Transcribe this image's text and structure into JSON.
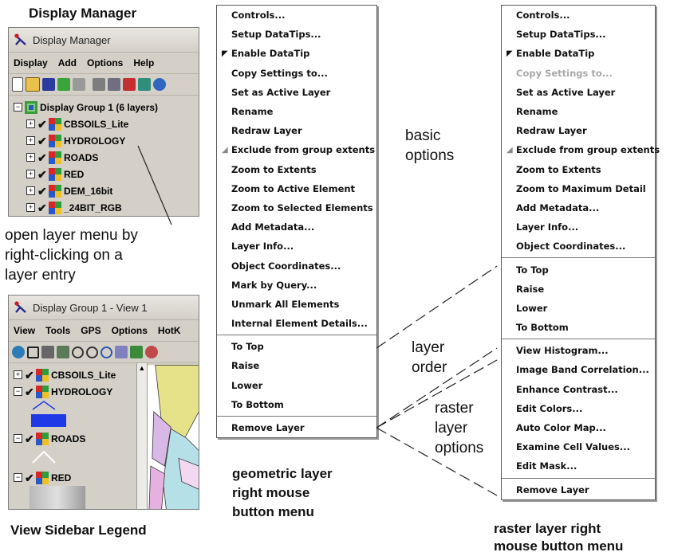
{
  "captions": {
    "display_manager": "Display Manager",
    "view_sidebar_legend": "View Sidebar Legend",
    "geometric_menu_lines": [
      "geometric layer",
      "right mouse",
      "button menu"
    ],
    "raster_menu_lines": [
      "raster layer right",
      "mouse button menu"
    ]
  },
  "annotations": {
    "open_layer_lines": [
      "open layer menu by",
      "right-clicking on a",
      "layer entry"
    ],
    "basic_options_lines": [
      "basic",
      "options"
    ],
    "layer_order_lines": [
      "layer",
      "order"
    ],
    "raster_options_lines": [
      "raster",
      "layer",
      "options"
    ]
  },
  "display_manager": {
    "title": "Display Manager",
    "menu": [
      "Display",
      "Add",
      "Options",
      "Help"
    ],
    "group_label": "Display Group 1  (6 layers)",
    "layers": [
      "CBSOILS_Lite",
      "HYDROLOGY",
      "ROADS",
      "RED",
      "DEM_16bit",
      "_24BIT_RGB"
    ]
  },
  "view_window": {
    "title": "Display Group 1 - View 1",
    "menu": [
      "View",
      "Tools",
      "GPS",
      "Options",
      "HotK"
    ],
    "layers": [
      "CBSOILS_Lite",
      "HYDROLOGY",
      "ROADS",
      "RED"
    ]
  },
  "geometric_menu": {
    "items": [
      "Controls...",
      "Setup DataTips...",
      "Enable DataTip",
      "Copy Settings to...",
      "Set as Active Layer",
      "Rename",
      "Redraw Layer",
      "Exclude from group extents",
      "Zoom to Extents",
      "Zoom to Active Element",
      "Zoom to Selected Elements",
      "Add Metadata...",
      "Layer Info...",
      "Object Coordinates...",
      "Mark by Query...",
      "Unmark All Elements",
      "Internal Element Details..."
    ],
    "order_items": [
      "To Top",
      "Raise",
      "Lower",
      "To Bottom"
    ],
    "remove_label": "Remove Layer"
  },
  "raster_menu": {
    "items": [
      "Controls...",
      "Setup DataTips...",
      "Enable DataTip",
      "Copy Settings to...",
      "Set as Active Layer",
      "Rename",
      "Redraw Layer",
      "Exclude from group extents",
      "Zoom to Extents",
      "Zoom to Maximum Detail",
      "Add Metadata...",
      "Layer Info...",
      "Object Coordinates..."
    ],
    "order_items": [
      "To Top",
      "Raise",
      "Lower",
      "To Bottom"
    ],
    "raster_items": [
      "View Histogram...",
      "Image Band Correlation...",
      "Enhance Contrast...",
      "Edit Colors...",
      "Auto Color Map...",
      "Examine Cell Values...",
      "Edit Mask..."
    ],
    "remove_label": "Remove Layer"
  },
  "colors": {
    "menu_border": "#5a5a5a",
    "disabled_text": "#a8a8a8",
    "window_bg": "#d4d0c8",
    "hydro_symbol": "#1f39e6"
  }
}
